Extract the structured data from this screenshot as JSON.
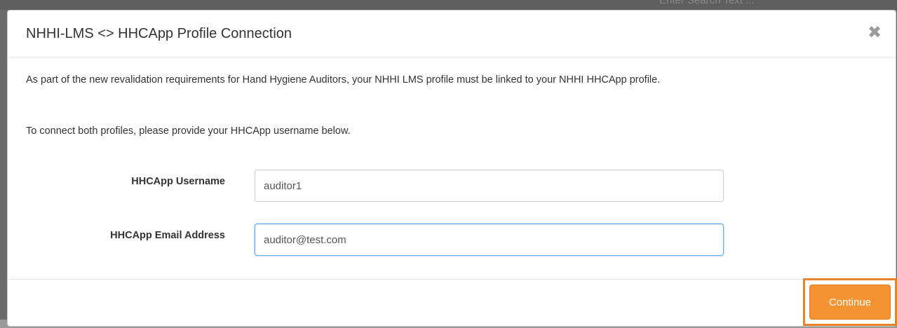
{
  "background": {
    "search_placeholder": "Enter Search Text ..."
  },
  "modal": {
    "title": "NHHI-LMS <> HHCApp Profile Connection",
    "close_glyph": "✖",
    "intro_text": "As part of the new revalidation requirements for Hand Hygiene Auditors, your NHHI LMS profile must be linked to your NHHI HHCApp profile.",
    "instruction_text": "To connect both profiles, please provide your HHCApp username below.",
    "form": {
      "username_label": "HHCApp Username",
      "username_value": "auditor1",
      "email_label": "HHCApp Email Address",
      "email_value": "auditor@test.com"
    },
    "footer": {
      "continue_label": "Continue"
    }
  },
  "colors": {
    "accent": "#f59231",
    "highlight_border": "#e8822b",
    "focus_border": "#66afe9"
  }
}
